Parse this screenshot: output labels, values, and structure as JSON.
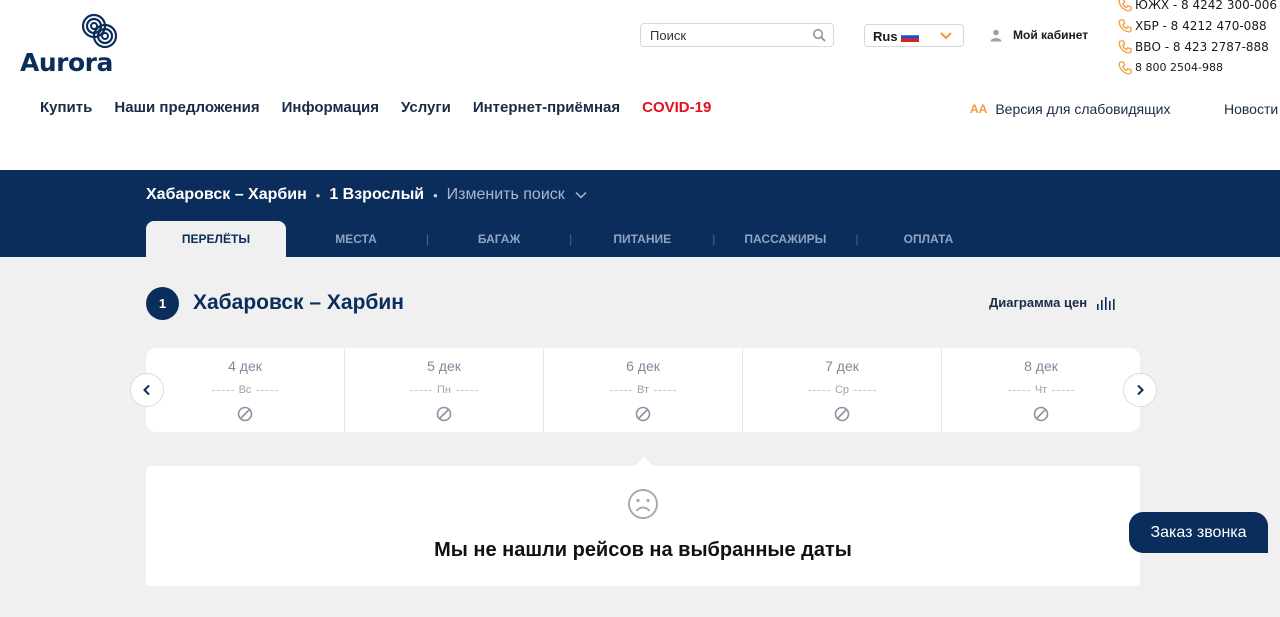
{
  "brand": {
    "logo_text": "Aurora",
    "primary_color": "#0b2d5b",
    "accent_color": "#f39c3a",
    "alert_color": "#e3101a"
  },
  "header": {
    "search": {
      "placeholder": "Поиск",
      "icon": "search-icon"
    },
    "language": {
      "label": "Rus",
      "flag": "russia-flag-icon"
    },
    "cabinet": {
      "label": "Мой кабинет",
      "icon": "user-icon"
    },
    "phones": [
      {
        "label": "ЮЖХ  -  8 4242 300-006"
      },
      {
        "label": "ХБР  -  8 4212 470-088"
      },
      {
        "label": "ВВО  -  8 423 2787-888"
      },
      {
        "label": "8 800 2504-988"
      }
    ]
  },
  "nav": {
    "items": [
      {
        "label": "Купить"
      },
      {
        "label": "Наши предложения"
      },
      {
        "label": "Информация"
      },
      {
        "label": "Услуги"
      },
      {
        "label": "Интернет-приёмная"
      },
      {
        "label": "COVID-19"
      }
    ],
    "vision": {
      "icon_text": "AA",
      "label": "Версия для слабовидящих"
    },
    "news": "Новости"
  },
  "booking": {
    "route": "Хабаровск  –  Харбин",
    "separator": "•",
    "passengers": "1 Взрослый",
    "change_search": "Изменить поиск",
    "tabs": [
      {
        "label": "ПЕРЕЛЁТЫ",
        "active": true
      },
      {
        "label": "МЕСТА"
      },
      {
        "label": "БАГАЖ"
      },
      {
        "label": "ПИТАНИЕ"
      },
      {
        "label": "ПАССАЖИРЫ"
      },
      {
        "label": "ОПЛАТА"
      }
    ],
    "tab_separator": "|"
  },
  "flights": {
    "step": "1",
    "title": "Хабаровск – Харбин",
    "price_chart": "Диаграмма цен",
    "dates": [
      {
        "date": "4 дек",
        "weekday": "Вс"
      },
      {
        "date": "5 дек",
        "weekday": "Пн"
      },
      {
        "date": "6 дек",
        "weekday": "Вт"
      },
      {
        "date": "7 дек",
        "weekday": "Ср"
      },
      {
        "date": "8 дек",
        "weekday": "Чт"
      }
    ],
    "empty_message": "Мы не нашли рейсов на выбранные даты"
  },
  "callback": {
    "label": "Заказ звонка"
  }
}
